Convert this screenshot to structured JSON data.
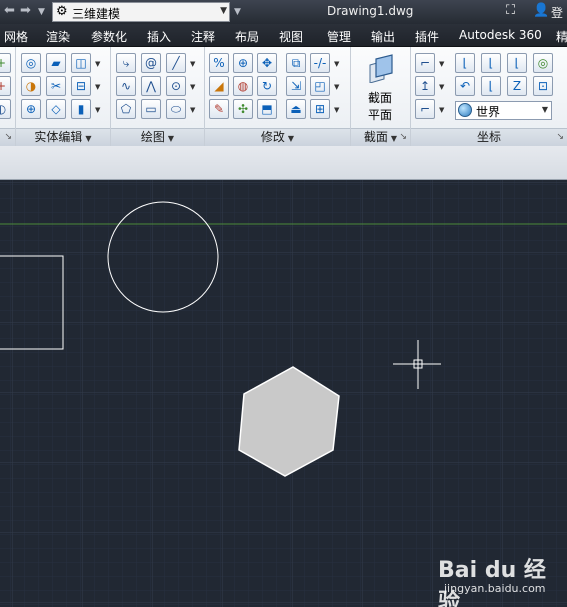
{
  "title_bar": {
    "quick_access": [
      "back-arrow-icon",
      "forward-arrow-icon",
      "dropdown-icon"
    ],
    "workspace": "三维建模",
    "document_title": "Drawing1.dwg",
    "right_items": [
      "binoculars-icon",
      "user-icon"
    ],
    "sign_in": "登"
  },
  "menu": {
    "tabs": [
      "网格",
      "渲染",
      "参数化",
      "插入",
      "注释",
      "布局",
      "视图",
      "管理",
      "输出",
      "插件",
      "Autodesk 360",
      "精"
    ]
  },
  "ribbon": {
    "panels": [
      {
        "id": "solid-edit",
        "title": "实体编辑"
      },
      {
        "id": "draw",
        "title": "绘图"
      },
      {
        "id": "modify",
        "title": "修改"
      },
      {
        "id": "section",
        "title": "截面"
      },
      {
        "id": "coordinates",
        "title": "坐标"
      }
    ],
    "section_plane": {
      "line1": "截面",
      "line2": "平面"
    },
    "ucs_select": {
      "value": "世界",
      "icon": "globe-icon"
    }
  },
  "drawing": {
    "shapes": [
      "circle",
      "rectangle",
      "hexagon",
      "crosshair-cursor"
    ],
    "colors": {
      "background": "#212833",
      "grid": "#2f3746",
      "outline": "#ffffff",
      "fill": "#c9c9c9",
      "axis_x": "#4c8a3a"
    }
  },
  "watermark": {
    "brand": "Bai du 经验",
    "url": "jingyan.baidu.com"
  }
}
